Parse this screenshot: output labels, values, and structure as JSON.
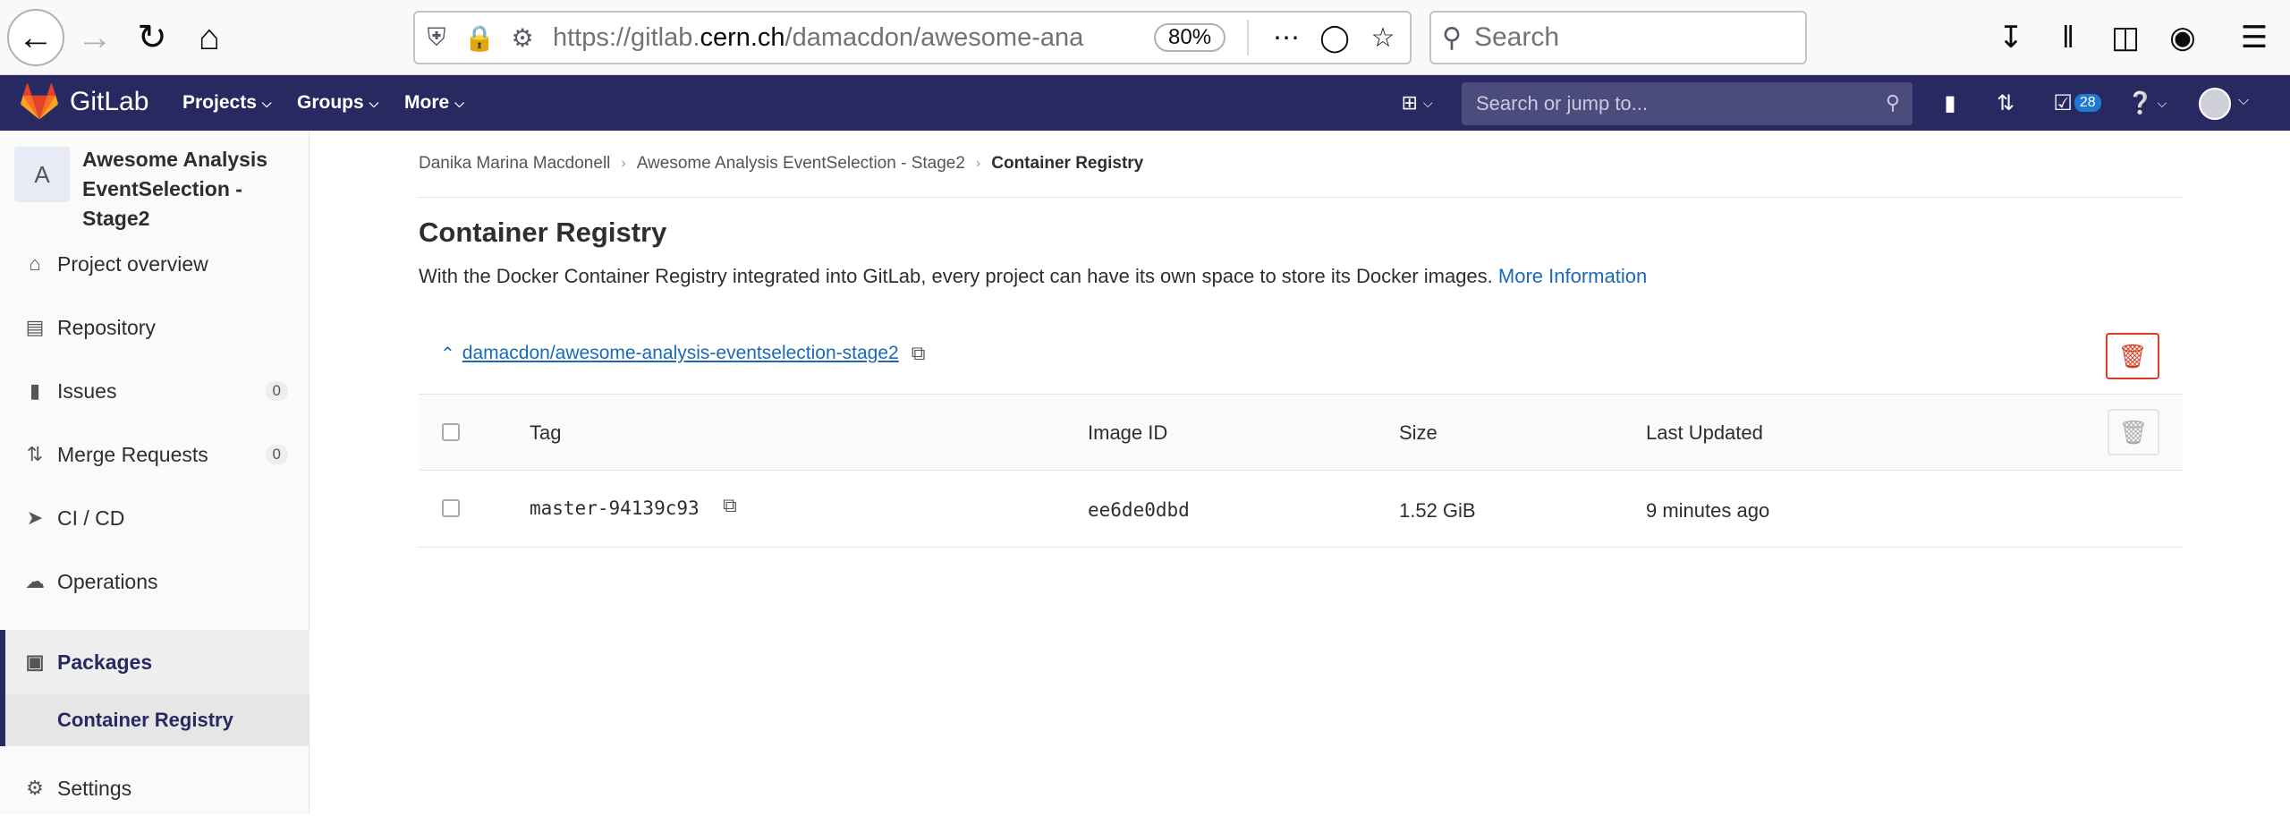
{
  "browser": {
    "url_prefix": "https://gitlab.",
    "url_domain": "cern.ch",
    "url_rest": "/damacdon/awesome-ana",
    "zoom": "80%",
    "search_placeholder": "Search"
  },
  "gitlab_nav": {
    "brand": "GitLab",
    "menus": [
      "Projects",
      "Groups",
      "More"
    ],
    "search_placeholder": "Search or jump to...",
    "todo_count": "28"
  },
  "sidebar": {
    "project_initial": "A",
    "project_name": "Awesome Analysis EventSelection - Stage2",
    "items": [
      {
        "label": "Project overview",
        "icon": "home-icon"
      },
      {
        "label": "Repository",
        "icon": "doc-icon"
      },
      {
        "label": "Issues",
        "icon": "issues-icon",
        "count": "0"
      },
      {
        "label": "Merge Requests",
        "icon": "merge-icon",
        "count": "0"
      },
      {
        "label": "CI / CD",
        "icon": "rocket-icon"
      },
      {
        "label": "Operations",
        "icon": "cloud-icon"
      },
      {
        "label": "Packages",
        "icon": "package-icon"
      },
      {
        "label": "Settings",
        "icon": "gear-icon"
      }
    ],
    "sub_item": "Container Registry"
  },
  "breadcrumb": [
    "Danika Marina Macdonell",
    "Awesome Analysis EventSelection - Stage2",
    "Container Registry"
  ],
  "page": {
    "title": "Container Registry",
    "intro": "With the Docker Container Registry integrated into GitLab, every project can have its own space to store its Docker images.",
    "more_link": "More Information",
    "repo_path": "damacdon/awesome-analysis-eventselection-stage2"
  },
  "table": {
    "headers": [
      "Tag",
      "Image ID",
      "Size",
      "Last Updated"
    ],
    "rows": [
      {
        "tag": "master-94139c93",
        "image_id": "ee6de0dbd",
        "size": "1.52 GiB",
        "updated": "9 minutes ago"
      }
    ]
  },
  "colors": {
    "nav_bg": "#292961",
    "link": "#1b69b6",
    "danger": "#db3b21"
  }
}
